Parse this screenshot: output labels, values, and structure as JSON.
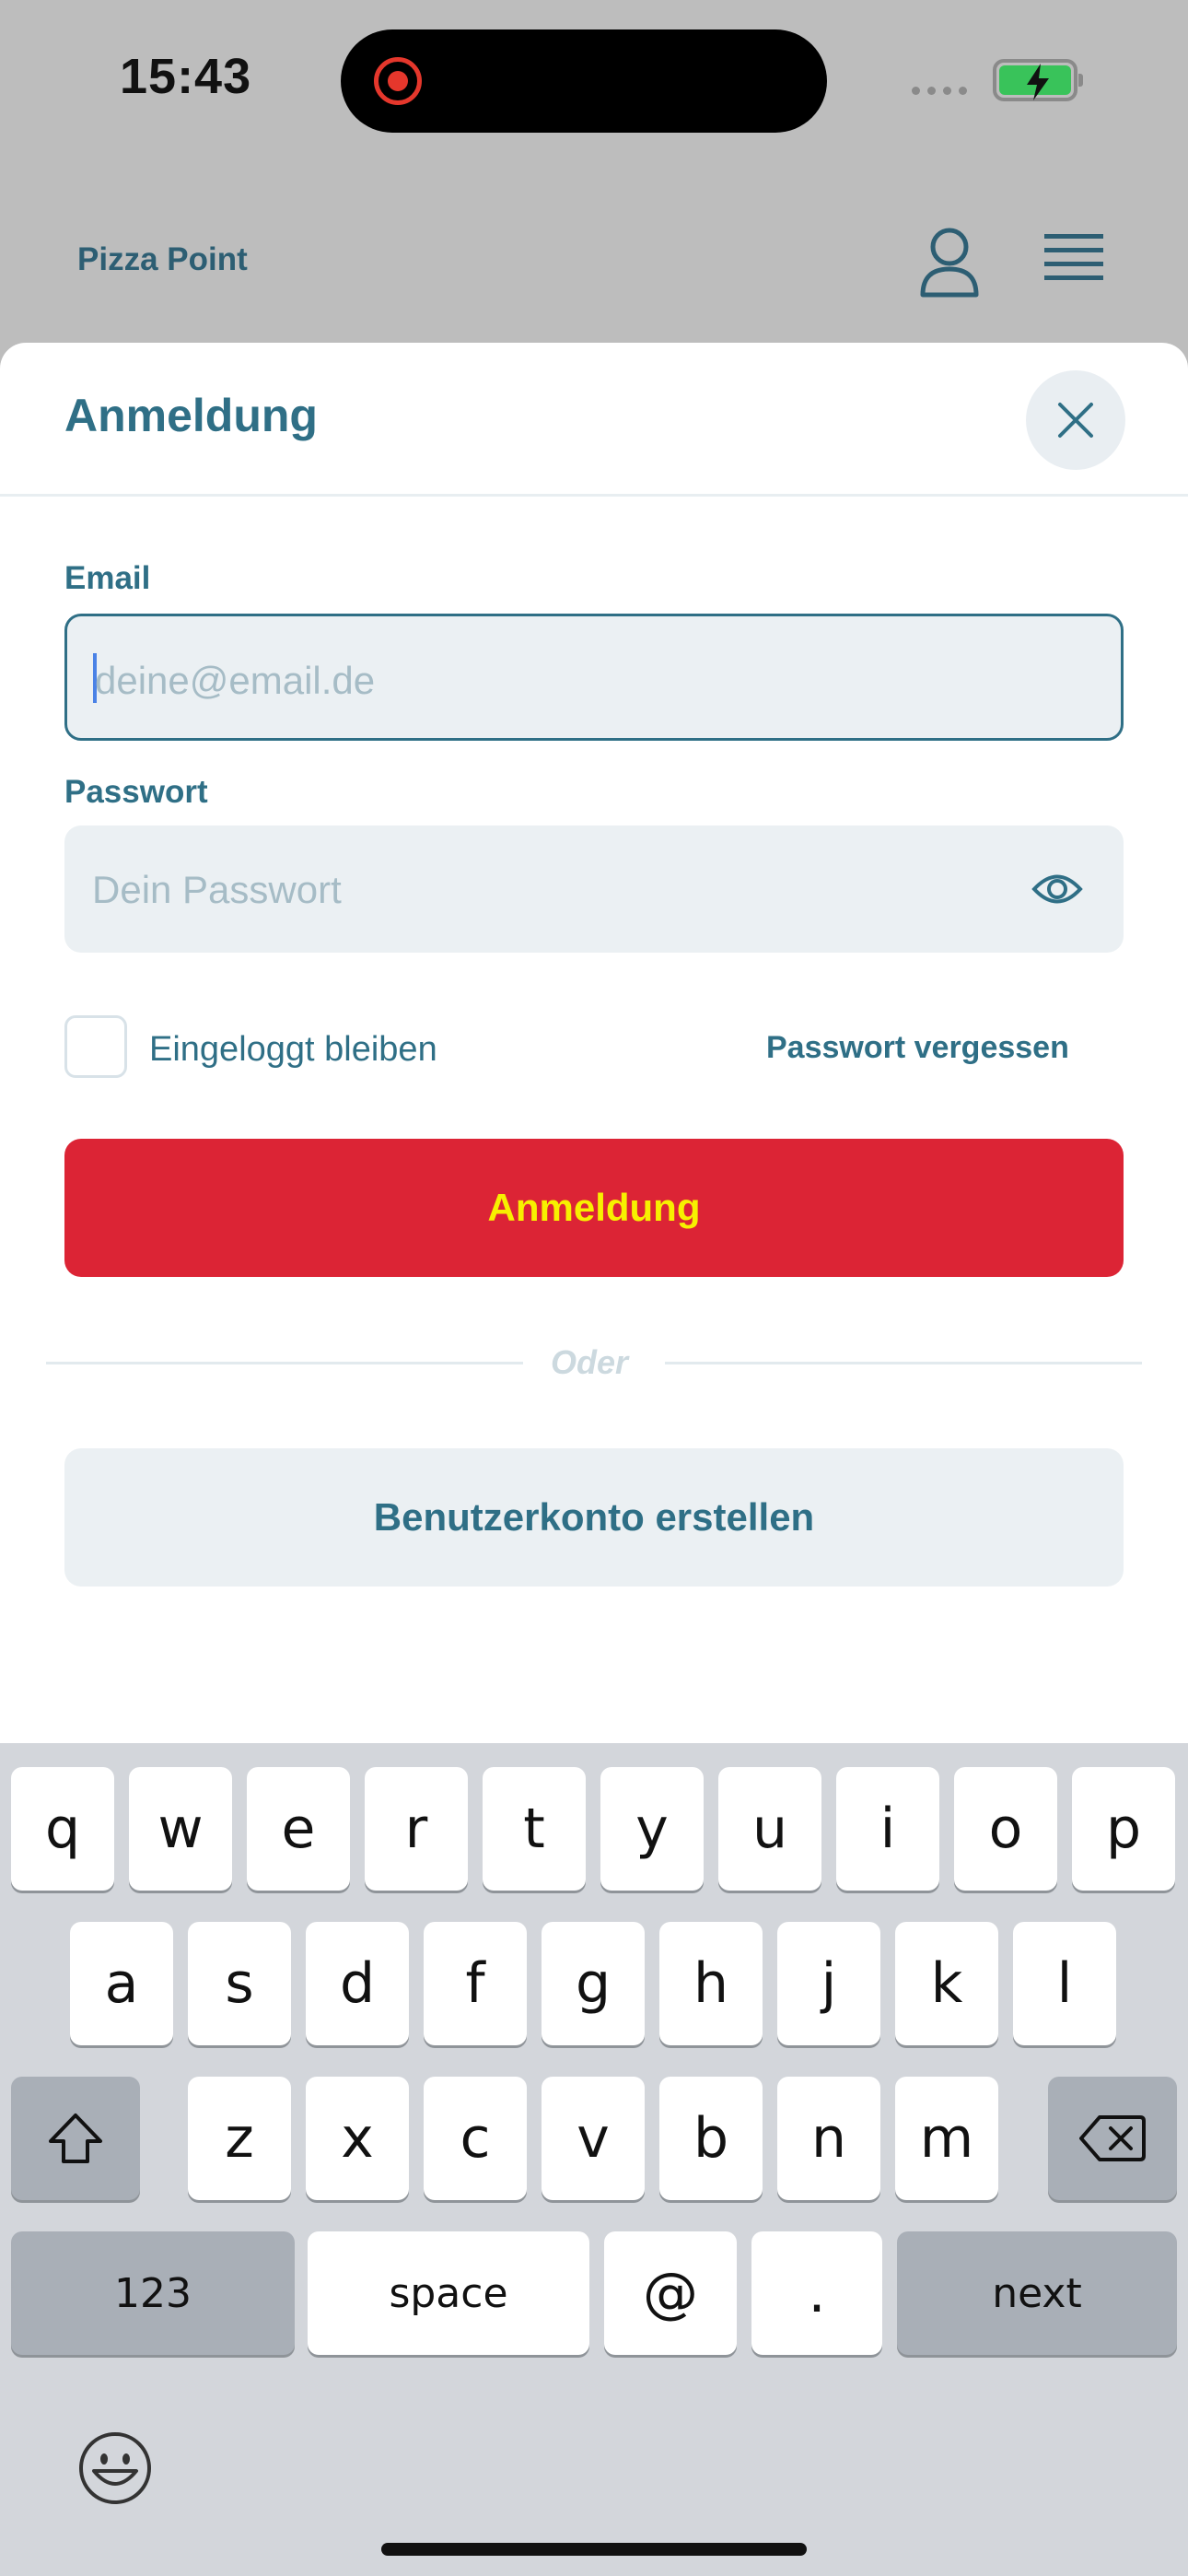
{
  "status_bar": {
    "time": "15:43"
  },
  "app_header": {
    "brand": "Pizza Point"
  },
  "sheet": {
    "title": "Anmeldung",
    "email": {
      "label": "Email",
      "placeholder": "deine@email.de"
    },
    "password": {
      "label": "Passwort",
      "placeholder": "Dein Passwort"
    },
    "remember_label": "Eingeloggt bleiben",
    "forgot_label": "Passwort vergessen",
    "login_button": "Anmeldung",
    "or_text": "Oder",
    "signup_button": "Benutzerkonto erstellen"
  },
  "colors": {
    "primary": "#2f6f86",
    "login_bg": "#dc2435",
    "login_text": "#f7f000",
    "field_bg": "#ebf0f3"
  },
  "keyboard": {
    "row1": [
      "q",
      "w",
      "e",
      "r",
      "t",
      "y",
      "u",
      "i",
      "o",
      "p"
    ],
    "row2": [
      "a",
      "s",
      "d",
      "f",
      "g",
      "h",
      "j",
      "k",
      "l"
    ],
    "row3": [
      "z",
      "x",
      "c",
      "v",
      "b",
      "n",
      "m"
    ],
    "numbers_key": "123",
    "space_key": "space",
    "at_key": "@",
    "dot_key": ".",
    "next_key": "next",
    "icons": [
      "shift-icon",
      "backspace-icon",
      "emoji-icon"
    ]
  }
}
